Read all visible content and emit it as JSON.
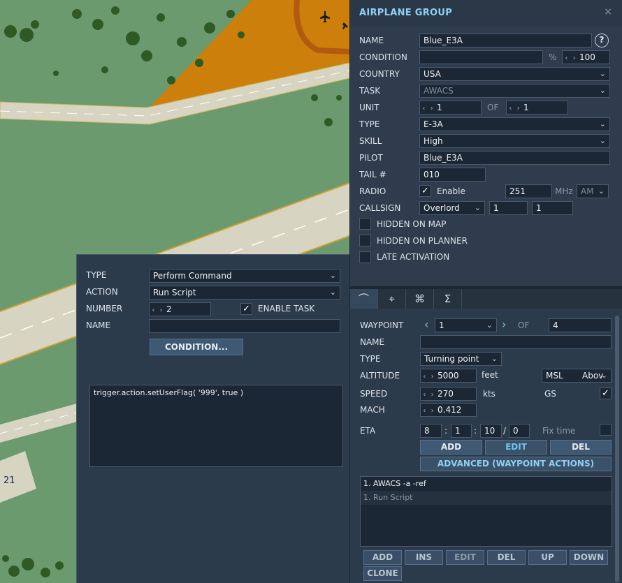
{
  "airplane_group": {
    "title": "AIRPLANE GROUP",
    "close_icon": "×",
    "name_label": "NAME",
    "name_value": "Blue_E3A",
    "help": "?",
    "condition_label": "CONDITION",
    "condition_value": "",
    "percent_symbol": "%",
    "condition_percent": "100",
    "country_label": "COUNTRY",
    "country_value": "USA",
    "task_label": "TASK",
    "task_value": "AWACS",
    "unit_label": "UNIT",
    "unit_value": "1",
    "of_label": "OF",
    "unit_total": "1",
    "type_label": "TYPE",
    "type_value": "E-3A",
    "skill_label": "SKILL",
    "skill_value": "High",
    "pilot_label": "PILOT",
    "pilot_value": "Blue_E3A",
    "tail_label": "TAIL #",
    "tail_value": "010",
    "radio_label": "RADIO",
    "radio_enable_label": "Enable",
    "radio_freq": "251",
    "radio_unit": "MHz",
    "radio_mod": "AM",
    "callsign_label": "CALLSIGN",
    "callsign_value": "Overlord",
    "callsign_num1": "1",
    "callsign_num2": "1",
    "hidden_on_map": "HIDDEN ON MAP",
    "hidden_on_planner": "HIDDEN ON PLANNER",
    "late_activation": "LATE ACTIVATION"
  },
  "tabs": [
    {
      "icon": "route-icon",
      "glyph": "⌒"
    },
    {
      "icon": "payload-icon",
      "glyph": "⌖"
    },
    {
      "icon": "settings-icon",
      "glyph": "⌘"
    },
    {
      "icon": "summary-icon",
      "glyph": "Σ"
    }
  ],
  "waypoint": {
    "waypoint_label": "WAYPOINT",
    "waypoint_value": "1",
    "of_label": "OF",
    "waypoint_total": "4",
    "name_label": "NAME",
    "name_value": "",
    "type_label": "TYPE",
    "type_value": "Turning point",
    "altitude_label": "ALTITUDE",
    "altitude_value": "5000",
    "altitude_unit": "feet",
    "altitude_ref": "MSL",
    "altitude_ref2": "Abov",
    "speed_label": "SPEED",
    "speed_value": "270",
    "speed_unit": "kts",
    "gs_label": "GS",
    "mach_label": "MACH",
    "mach_value": "0.412",
    "eta_label": "ETA",
    "eta_d": "8",
    "eta_h": "1",
    "eta_m": "10",
    "eta_s": "0",
    "sep_colon": ":",
    "sep_slash": "/",
    "fix_time_label": "Fix time",
    "add": "ADD",
    "edit": "EDIT",
    "del": "DEL",
    "advanced": "ADVANCED (WAYPOINT ACTIONS)"
  },
  "actions_list": {
    "items": [
      "1. AWACS -a -ref",
      "1. Run Script"
    ]
  },
  "action_buttons": {
    "add": "ADD",
    "ins": "INS",
    "edit": "EDIT",
    "del": "DEL",
    "up": "UP",
    "down": "DOWN",
    "clone": "CLONE"
  },
  "task_panel": {
    "type_label": "TYPE",
    "type_value": "Perform Command",
    "action_label": "ACTION",
    "action_value": "Run Script",
    "number_label": "NUMBER",
    "number_value": "2",
    "enable_task": "ENABLE TASK",
    "name_label": "NAME",
    "name_value": "",
    "condition_button": "CONDITION...",
    "script": "trigger.action.setUserFlag( '999', true )"
  },
  "map": {
    "runway_number": "21"
  }
}
